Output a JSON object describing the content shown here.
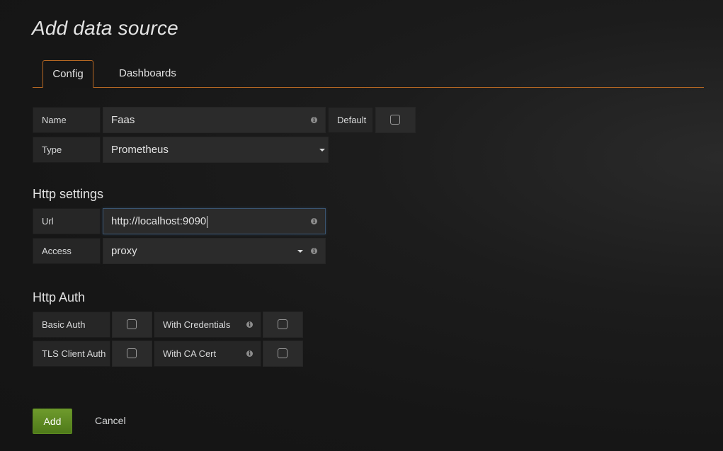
{
  "page": {
    "title": "Add data source"
  },
  "tabs": [
    {
      "label": "Config",
      "active": true
    },
    {
      "label": "Dashboards",
      "active": false
    }
  ],
  "form": {
    "name_label": "Name",
    "name_value": "Faas",
    "default_label": "Default",
    "default_checked": false,
    "type_label": "Type",
    "type_value": "Prometheus"
  },
  "http_settings": {
    "title": "Http settings",
    "url_label": "Url",
    "url_value": "http://localhost:9090",
    "access_label": "Access",
    "access_value": "proxy"
  },
  "http_auth": {
    "title": "Http Auth",
    "basic_auth_label": "Basic Auth",
    "basic_auth_checked": false,
    "with_credentials_label": "With Credentials",
    "with_credentials_checked": false,
    "tls_client_auth_label": "TLS Client Auth",
    "tls_client_auth_checked": false,
    "with_ca_cert_label": "With CA Cert",
    "with_ca_cert_checked": false
  },
  "actions": {
    "add_label": "Add",
    "cancel_label": "Cancel"
  },
  "colors": {
    "accent_orange": "#b56723",
    "button_green": "#5c8a20",
    "background": "#161616"
  },
  "icons": {
    "info": "info-icon",
    "dropdown": "caret-down-icon"
  }
}
